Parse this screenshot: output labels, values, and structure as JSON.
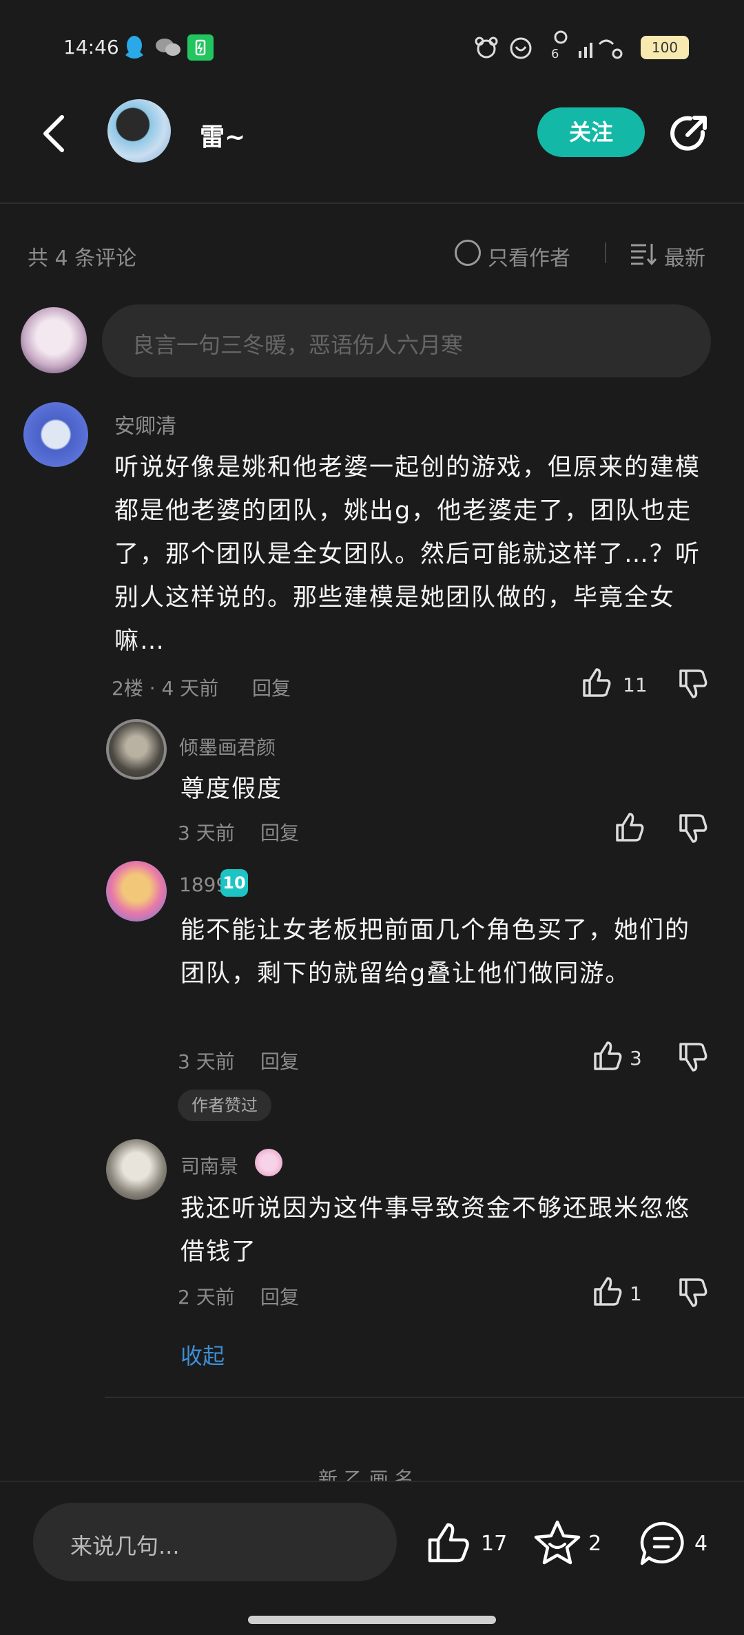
{
  "status_bar": {
    "time": "14:46",
    "battery": "100"
  },
  "header": {
    "username": "雷~",
    "follow_label": "关注"
  },
  "filter_bar": {
    "count_label": "共 4 条评论",
    "author_only_label": "只看作者",
    "sort_label": "最新"
  },
  "composer": {
    "placeholder": "良言一句三冬暖，恶语伤人六月寒"
  },
  "main_comment": {
    "author": "安卿清",
    "text": "听说好像是姚和他老婆一起创的游戏，但原来的建模都是他老婆的团队，姚出g，他老婆走了，团队也走了，那个团队是全女团队。然后可能就这样了…？听别人这样说的。那些建模是她团队做的，毕竟全女嘛…",
    "meta": "2楼 · 4 天前",
    "reply_label": "回复",
    "likes": "11"
  },
  "replies": [
    {
      "author": "倾墨画君颜",
      "text": "尊度假度",
      "time": "3 天前",
      "reply_label": "回复",
      "likes": ""
    },
    {
      "author": "1899",
      "level": "10",
      "text": "能不能让女老板把前面几个角色买了，她们的团队，剩下的就留给g叠让他们做同游。",
      "time": "3 天前",
      "reply_label": "回复",
      "likes": "3",
      "badge": "作者赞过"
    },
    {
      "author": "司南景",
      "text": "我还听说因为这件事导致资金不够还跟米忽悠借钱了",
      "time": "2 天前",
      "reply_label": "回复",
      "likes": "1"
    }
  ],
  "collapse_label": "收起",
  "cut_off_text": "新 乙 画 名",
  "bottom_bar": {
    "input_placeholder": "来说几句...",
    "likes": "17",
    "favorites": "2",
    "comments": "4"
  },
  "colors": {
    "background": "#1b1b1b",
    "accent": "#14b8a6",
    "link_blue": "#3d8fd6",
    "level_badge": "#1ec4c4"
  }
}
